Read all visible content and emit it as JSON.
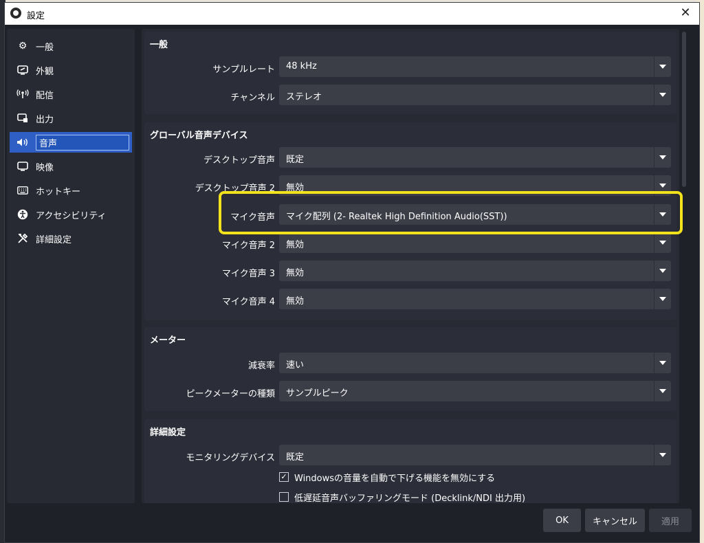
{
  "window": {
    "title": "設定"
  },
  "sidebar": {
    "items": [
      {
        "label": "一般",
        "icon": "gear-icon"
      },
      {
        "label": "外観",
        "icon": "appearance-icon"
      },
      {
        "label": "配信",
        "icon": "broadcast-icon"
      },
      {
        "label": "出力",
        "icon": "output-icon"
      },
      {
        "label": "音声",
        "icon": "speaker-icon"
      },
      {
        "label": "映像",
        "icon": "monitor-icon"
      },
      {
        "label": "ホットキー",
        "icon": "keyboard-icon"
      },
      {
        "label": "アクセシビリティ",
        "icon": "accessibility-icon"
      },
      {
        "label": "詳細設定",
        "icon": "tools-icon"
      }
    ],
    "active_index": 4
  },
  "general": {
    "title": "一般",
    "sample_rate": {
      "label": "サンプルレート",
      "value": "48 kHz"
    },
    "channel": {
      "label": "チャンネル",
      "value": "ステレオ"
    }
  },
  "devices": {
    "title": "グローバル音声デバイス",
    "rows": [
      {
        "label": "デスクトップ音声",
        "value": "既定"
      },
      {
        "label": "デスクトップ音声 2",
        "value": "無効"
      },
      {
        "label": "マイク音声",
        "value": "マイク配列 (2- Realtek High Definition Audio(SST))"
      },
      {
        "label": "マイク音声 2",
        "value": "無効"
      },
      {
        "label": "マイク音声 3",
        "value": "無効"
      },
      {
        "label": "マイク音声 4",
        "value": "無効"
      }
    ]
  },
  "meters": {
    "title": "メーター",
    "decay": {
      "label": "減衰率",
      "value": "速い"
    },
    "peak_type": {
      "label": "ピークメーターの種類",
      "value": "サンプルピーク"
    }
  },
  "advanced": {
    "title": "詳細設定",
    "monitoring": {
      "label": "モニタリングデバイス",
      "value": "既定"
    },
    "ducking": {
      "label": "Windowsの音量を自動で下げる機能を無効にする",
      "checked": true
    },
    "low_latency": {
      "label": "低遅延音声バッファリングモード (Decklink/NDI 出力用)",
      "checked": false
    }
  },
  "buttons": {
    "ok": "OK",
    "cancel": "キャンセル",
    "apply": "適用"
  },
  "colors": {
    "accent": "#2f5fc4",
    "highlight": "#f2e21c"
  }
}
